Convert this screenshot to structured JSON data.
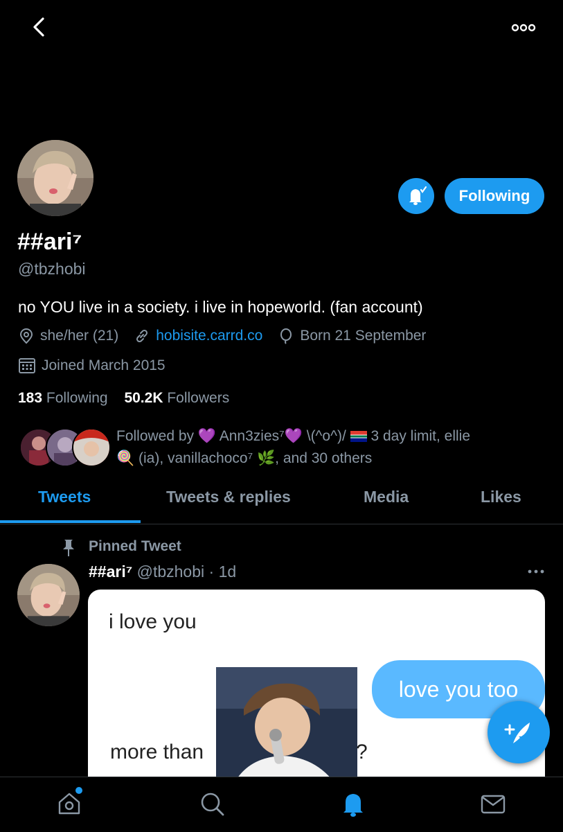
{
  "profile": {
    "display_name": "##ari⁷",
    "handle": "@tbzhobi",
    "bio": "no YOU live in a society. i live in hopeworld. (fan account)",
    "pronouns": "she/her (21)",
    "website": "hobisite.carrd.co",
    "birthday": "Born 21 September",
    "joined": "Joined March 2015",
    "following_count": "183",
    "following_label": "Following",
    "followers_count": "50.2K",
    "followers_label": "Followers",
    "follow_button_label": "Following"
  },
  "followed_by": {
    "text_prefix": "Followed by ",
    "name1": "Ann3zies⁷",
    "name2": "\\(^o^)/",
    "name3": "3 day limit, ellie",
    "name4": "(ia), vanillachoco⁷",
    "suffix": ", and 30 others"
  },
  "tabs": [
    {
      "label": "Tweets"
    },
    {
      "label": "Tweets & replies"
    },
    {
      "label": "Media"
    },
    {
      "label": "Likes"
    }
  ],
  "pinned_tweet": {
    "pinned_label": "Pinned Tweet",
    "author_name": "##ari⁷",
    "author_handle": "@tbzhobi",
    "time": "· 1d",
    "media_text1": "i love you",
    "media_bubble": "love you too",
    "media_text2": "more than",
    "media_q": "?"
  },
  "colors": {
    "accent": "#1d9bf0",
    "background": "#000000",
    "muted": "#8b98a5"
  },
  "icons": [
    "back-icon",
    "more-icon",
    "bell-icon",
    "location-icon",
    "link-icon",
    "balloon-icon",
    "calendar-icon",
    "pin-icon",
    "compose-icon",
    "home-icon",
    "search-icon",
    "notifications-icon",
    "messages-icon"
  ]
}
